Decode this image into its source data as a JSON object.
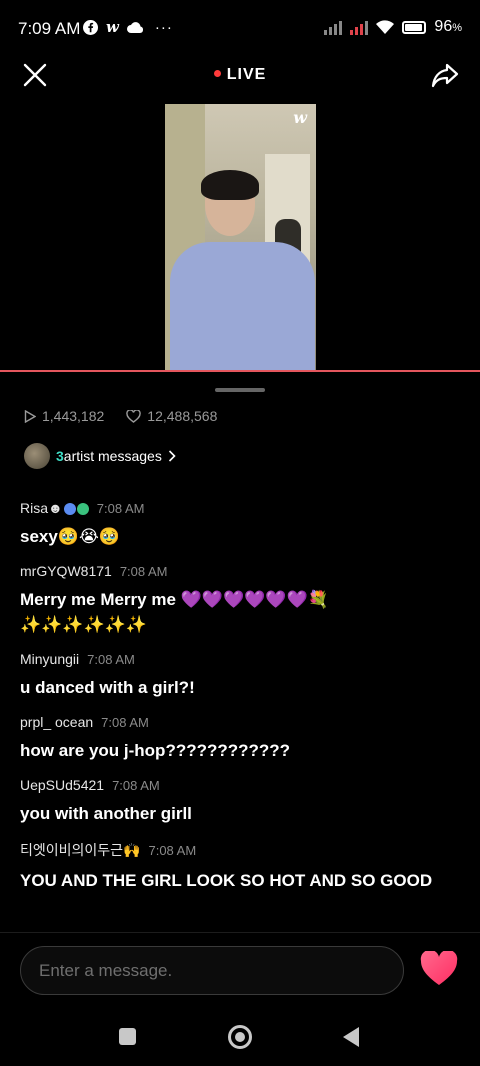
{
  "status_bar": {
    "time": "7:09 AM",
    "left_icons": [
      "facebook-icon",
      "weverse-icon",
      "cloud-icon",
      "more-icon"
    ],
    "more_label": "···",
    "battery": "96"
  },
  "header": {
    "live_label": "LIVE"
  },
  "video": {
    "logo": "w"
  },
  "stats": {
    "plays": "1,443,182",
    "likes": "12,488,568"
  },
  "artist_messages": {
    "count": "3",
    "label": "artist messages"
  },
  "chat": [
    {
      "user": "Risa☻",
      "time": "7:08 AM",
      "text": "sexy🥹😭🥹"
    },
    {
      "user": "mrGYQW8171",
      "time": "7:08 AM",
      "text": "Merry me Merry me 💜💜💜💜💜💜💐 ✨✨✨✨✨✨"
    },
    {
      "user": "Minyungii",
      "time": "7:08 AM",
      "text": "u danced with a girl?!"
    },
    {
      "user": "prpl_ ocean",
      "time": "7:08 AM",
      "text": "how are you j-hop????????????"
    },
    {
      "user": "UepSUd5421",
      "time": "7:08 AM",
      "text": "you with another girll"
    },
    {
      "user": "티엣이비의이두근🙌",
      "time": "7:08 AM",
      "text": "YOU AND THE GIRL LOOK SO HOT AND SO GOOD"
    }
  ],
  "input": {
    "placeholder": "Enter a message."
  },
  "colors": {
    "accent_live": "#ff3b3b",
    "artist_accent": "#3ddbc4",
    "heart": "#ff3d6e",
    "progress": "#e4565d"
  }
}
